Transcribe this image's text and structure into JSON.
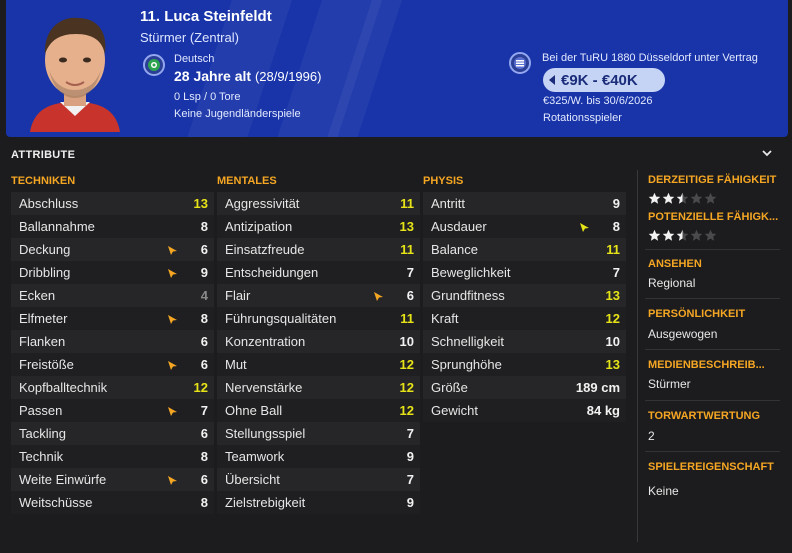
{
  "player": {
    "name": "11. Luca Steinfeldt",
    "position": "Stürmer (Zentral)",
    "nationality": "Deutsch",
    "age": "28 Jahre alt",
    "dob": "(28/9/1996)",
    "apps": "0 Lsp / 0 Tore",
    "youth": "Keine Jugendländerspiele",
    "club_text": "Bei der TuRU 1880 Düsseldorf unter Vertrag",
    "wage_range": "€9K - €40K",
    "contract": "€325/W. bis 30/6/2026",
    "squad_status": "Rotationsspieler"
  },
  "section_title": "ATTRIBUTE",
  "columns": [
    {
      "title": "TECHNIKEN",
      "rows": [
        {
          "name": "Abschluss",
          "value": "13",
          "color": "yellow",
          "arrow": ""
        },
        {
          "name": "Ballannahme",
          "value": "8",
          "color": "white",
          "arrow": ""
        },
        {
          "name": "Deckung",
          "value": "6",
          "color": "white",
          "arrow": "orange"
        },
        {
          "name": "Dribbling",
          "value": "9",
          "color": "white",
          "arrow": "orange"
        },
        {
          "name": "Ecken",
          "value": "4",
          "color": "grey",
          "arrow": ""
        },
        {
          "name": "Elfmeter",
          "value": "8",
          "color": "white",
          "arrow": "orange"
        },
        {
          "name": "Flanken",
          "value": "6",
          "color": "white",
          "arrow": ""
        },
        {
          "name": "Freistöße",
          "value": "6",
          "color": "white",
          "arrow": "orange"
        },
        {
          "name": "Kopfballtechnik",
          "value": "12",
          "color": "yellow",
          "arrow": ""
        },
        {
          "name": "Passen",
          "value": "7",
          "color": "white",
          "arrow": "orange"
        },
        {
          "name": "Tackling",
          "value": "6",
          "color": "white",
          "arrow": ""
        },
        {
          "name": "Technik",
          "value": "8",
          "color": "white",
          "arrow": ""
        },
        {
          "name": "Weite Einwürfe",
          "value": "6",
          "color": "white",
          "arrow": "orange"
        },
        {
          "name": "Weitschüsse",
          "value": "8",
          "color": "white",
          "arrow": ""
        }
      ]
    },
    {
      "title": "MENTALES",
      "rows": [
        {
          "name": "Aggressivität",
          "value": "11",
          "color": "yellow",
          "arrow": ""
        },
        {
          "name": "Antizipation",
          "value": "13",
          "color": "yellow",
          "arrow": ""
        },
        {
          "name": "Einsatzfreude",
          "value": "11",
          "color": "yellow",
          "arrow": ""
        },
        {
          "name": "Entscheidungen",
          "value": "7",
          "color": "white",
          "arrow": ""
        },
        {
          "name": "Flair",
          "value": "6",
          "color": "white",
          "arrow": "orange"
        },
        {
          "name": "Führungsqualitäten",
          "value": "11",
          "color": "yellow",
          "arrow": ""
        },
        {
          "name": "Konzentration",
          "value": "10",
          "color": "white",
          "arrow": ""
        },
        {
          "name": "Mut",
          "value": "12",
          "color": "yellow",
          "arrow": ""
        },
        {
          "name": "Nervenstärke",
          "value": "12",
          "color": "yellow",
          "arrow": ""
        },
        {
          "name": "Ohne Ball",
          "value": "12",
          "color": "yellow",
          "arrow": ""
        },
        {
          "name": "Stellungsspiel",
          "value": "7",
          "color": "white",
          "arrow": ""
        },
        {
          "name": "Teamwork",
          "value": "9",
          "color": "white",
          "arrow": ""
        },
        {
          "name": "Übersicht",
          "value": "7",
          "color": "white",
          "arrow": ""
        },
        {
          "name": "Zielstrebigkeit",
          "value": "9",
          "color": "white",
          "arrow": ""
        }
      ]
    },
    {
      "title": "PHYSIS",
      "rows": [
        {
          "name": "Antritt",
          "value": "9",
          "color": "white",
          "arrow": ""
        },
        {
          "name": "Ausdauer",
          "value": "8",
          "color": "white",
          "arrow": "yellow"
        },
        {
          "name": "Balance",
          "value": "11",
          "color": "yellow",
          "arrow": ""
        },
        {
          "name": "Beweglichkeit",
          "value": "7",
          "color": "white",
          "arrow": ""
        },
        {
          "name": "Grundfitness",
          "value": "13",
          "color": "yellow",
          "arrow": ""
        },
        {
          "name": "Kraft",
          "value": "12",
          "color": "yellow",
          "arrow": ""
        },
        {
          "name": "Schnelligkeit",
          "value": "10",
          "color": "white",
          "arrow": ""
        },
        {
          "name": "Sprunghöhe",
          "value": "13",
          "color": "yellow",
          "arrow": ""
        }
      ],
      "extra": [
        {
          "name": "Größe",
          "value": "189 cm"
        },
        {
          "name": "Gewicht",
          "value": "84 kg"
        }
      ]
    }
  ],
  "side": {
    "current_ability_label": "DERZEITIGE FÄHIGKEIT",
    "current_ability_stars": 2.5,
    "potential_ability_label": "POTENZIELLE FÄHIGK...",
    "potential_ability_stars": 2.5,
    "reputation_label": "ANSEHEN",
    "reputation_value": "Regional",
    "personality_label": "PERSÖNLICHKEIT",
    "personality_value": "Ausgewogen",
    "media_label": "MEDIENBESCHREIB...",
    "media_value": "Stürmer",
    "gk_label": "TORWARTWERTUNG",
    "gk_value": "2",
    "traits_label": "SPIELEREIGENSCHAFT",
    "traits_value": "Keine"
  },
  "colors": {
    "header_bg": "#1834a8",
    "accent": "#f5a623",
    "value_yellow": "#e6e317",
    "value_white": "#f2f2f2",
    "value_grey": "#8a8a8a"
  }
}
